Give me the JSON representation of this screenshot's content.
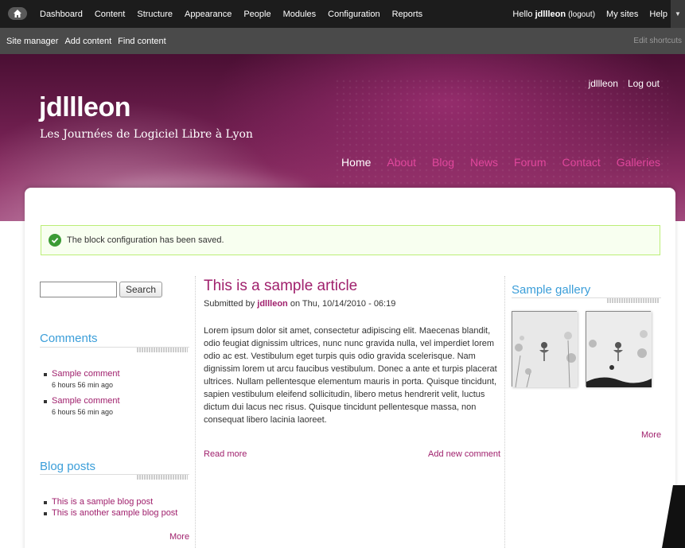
{
  "toolbar": {
    "menu": [
      "Dashboard",
      "Content",
      "Structure",
      "Appearance",
      "People",
      "Modules",
      "Configuration",
      "Reports"
    ],
    "hello": "Hello",
    "username": "jdllleon",
    "logout": "(logout)",
    "my_sites": "My sites",
    "help": "Help"
  },
  "shortcuts": {
    "items": [
      "Site manager",
      "Add content",
      "Find content"
    ],
    "edit": "Edit shortcuts"
  },
  "header": {
    "site_name": "jdllleon",
    "slogan": "Les Journées de Logiciel Libre à Lyon",
    "user_links": [
      "jdllleon",
      "Log out"
    ],
    "main_menu": [
      "Home",
      "About",
      "Blog",
      "News",
      "Forum",
      "Contact",
      "Galleries"
    ]
  },
  "message": "The block configuration has been saved.",
  "search": {
    "button": "Search",
    "placeholder": ""
  },
  "comments": {
    "title": "Comments",
    "items": [
      {
        "label": "Sample comment",
        "meta": "6 hours 56 min ago"
      },
      {
        "label": "Sample comment",
        "meta": "6 hours 56 min ago"
      }
    ]
  },
  "blog_posts": {
    "title": "Blog posts",
    "items": [
      "This is a sample blog post",
      "This is another sample blog post"
    ],
    "more": "More"
  },
  "article": {
    "title": "This is a sample article",
    "submitted_prefix": "Submitted by",
    "author": "jdllleon",
    "date": "on Thu, 10/14/2010 - 06:19",
    "body": "Lorem ipsum dolor sit amet, consectetur adipiscing elit. Maecenas blandit, odio feugiat dignissim ultrices, nunc nunc gravida nulla, vel imperdiet lorem odio ac est. Vestibulum eget turpis quis odio gravida scelerisque. Nam dignissim lorem ut arcu faucibus vestibulum. Donec a ante et turpis placerat ultrices. Nullam pellentesque elementum mauris in porta. Quisque tincidunt, sapien vestibulum eleifend sollicitudin, libero metus hendrerit velit, luctus dictum dui lacus nec risus. Quisque tincidunt pellentesque massa, non consequat libero lacinia laoreet.",
    "read_more": "Read more",
    "add_comment": "Add new comment"
  },
  "gallery": {
    "title": "Sample gallery",
    "more": "More"
  },
  "colors": {
    "accent": "#a0216d",
    "block_title": "#3b9ed9",
    "menu_link": "#e0479c"
  }
}
